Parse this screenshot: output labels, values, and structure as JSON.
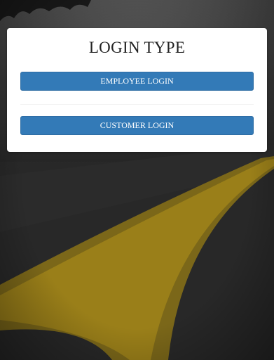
{
  "login_card": {
    "title": "LOGIN TYPE",
    "employee_button_label": "EMPLOYEE LOGIN",
    "customer_button_label": "CUSTOMER LOGIN"
  },
  "colors": {
    "button_primary": "#337ab7",
    "card_background": "#ffffff",
    "road_line": "#b8961c"
  }
}
